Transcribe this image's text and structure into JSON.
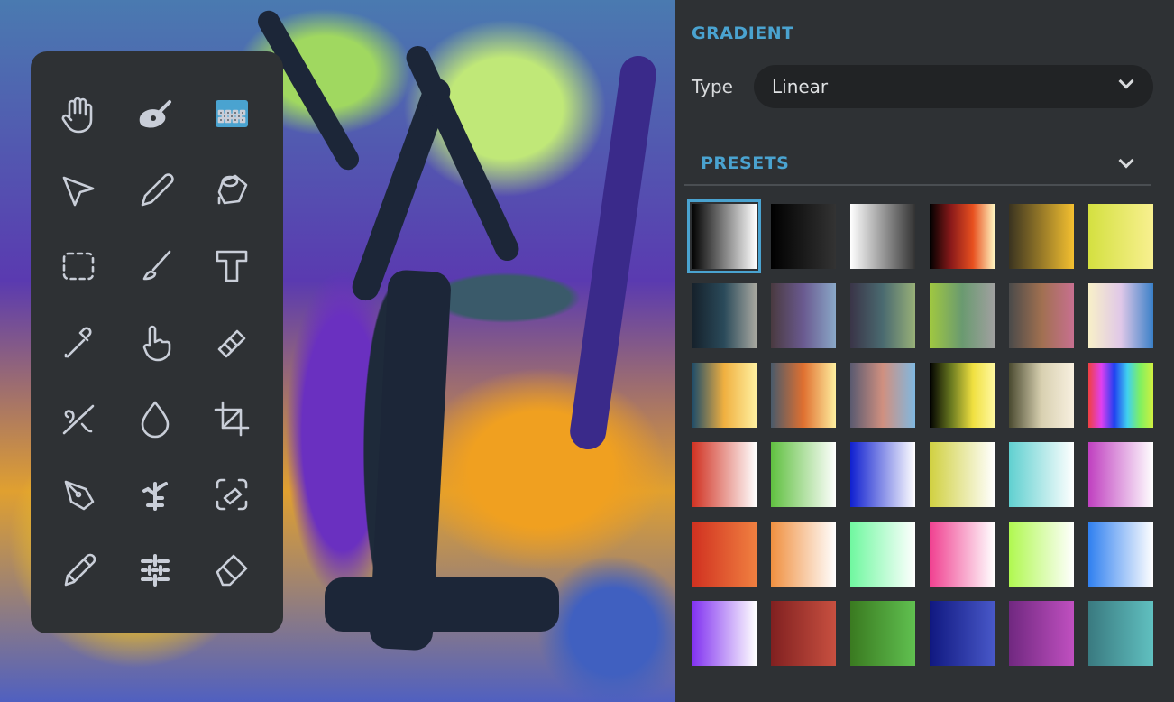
{
  "canvas": {
    "name": "painting-canvas"
  },
  "toolbar": {
    "tools": [
      {
        "id": "hand",
        "active": false
      },
      {
        "id": "palette",
        "active": false
      },
      {
        "id": "gradient",
        "active": true
      },
      {
        "id": "select-arrow",
        "active": false
      },
      {
        "id": "pencil",
        "active": false
      },
      {
        "id": "paint-bucket",
        "active": false
      },
      {
        "id": "marquee",
        "active": false
      },
      {
        "id": "brush",
        "active": false
      },
      {
        "id": "text",
        "active": false
      },
      {
        "id": "eyedropper",
        "active": false
      },
      {
        "id": "finger-smudge",
        "active": false
      },
      {
        "id": "stamp",
        "active": false
      },
      {
        "id": "stroke-pen",
        "active": false
      },
      {
        "id": "blur-drop",
        "active": false
      },
      {
        "id": "crop",
        "active": false
      },
      {
        "id": "pen-nib",
        "active": false
      },
      {
        "id": "tree-pattern",
        "active": false
      },
      {
        "id": "eraser-select",
        "active": false
      },
      {
        "id": "pencil-alt",
        "active": false
      },
      {
        "id": "grid-pattern",
        "active": false
      },
      {
        "id": "eraser",
        "active": false
      }
    ],
    "accent": "#4aa3d0"
  },
  "panel": {
    "gradient_title": "GRADIENT",
    "type_label": "Type",
    "type_value": "Linear",
    "presets_title": "PRESETS",
    "selected_index": 0,
    "presets": [
      [
        "#000000",
        "#ffffff"
      ],
      [
        "#000000",
        "#333333"
      ],
      [
        "#ffffff",
        "#333333"
      ],
      [
        "#000000",
        "#8b1a1a",
        "#e8501f",
        "#fff5c0"
      ],
      [
        "#3a3320",
        "#f4c030"
      ],
      [
        "#d4e040",
        "#f8f090"
      ],
      [
        "#15202a",
        "#2a4a5a",
        "#a8a8a0"
      ],
      [
        "#4a3a40",
        "#6a5a90",
        "#8aa8c8"
      ],
      [
        "#3a3548",
        "#4a6a70",
        "#98b078"
      ],
      [
        "#a0c840",
        "#6a9a70",
        "#a0a0a0"
      ],
      [
        "#4a4a4a",
        "#a07050",
        "#c87090"
      ],
      [
        "#f8f0c8",
        "#e0c8e8",
        "#3a80c8"
      ],
      [
        "#1a4a6a",
        "#f0b040",
        "#fff0a0"
      ],
      [
        "#4a5a6a",
        "#e07030",
        "#fff0a0"
      ],
      [
        "#5a5a70",
        "#d09080",
        "#80b8e0"
      ],
      [
        "#000000",
        "#6a7a20",
        "#f0e040",
        "#fff8a0"
      ],
      [
        "#4a4a30",
        "#d8d0b0",
        "#f8f0e0"
      ],
      [
        "#f04040",
        "#e040f0",
        "#2040f0",
        "#40d0f0",
        "#80f060",
        "#d0f040"
      ],
      [
        "#d03020",
        "#ffffff"
      ],
      [
        "#60c040",
        "#ffffff"
      ],
      [
        "#1020d0",
        "#ffffff"
      ],
      [
        "#d0d040",
        "#ffffff"
      ],
      [
        "#60d0d0",
        "#ffffff"
      ],
      [
        "#c040c0",
        "#ffffff"
      ],
      [
        "#d03020",
        "#f08040"
      ],
      [
        "#f09040",
        "#ffffff"
      ],
      [
        "#70f8a0",
        "#ffffff"
      ],
      [
        "#f04090",
        "#ffffff"
      ],
      [
        "#b0f850",
        "#ffffff"
      ],
      [
        "#3080f0",
        "#ffffff"
      ],
      [
        "#8030f0",
        "#ffffff"
      ],
      [
        "#802020",
        "#c85040"
      ],
      [
        "#3a7a20",
        "#60c050"
      ],
      [
        "#101880",
        "#4858c8"
      ],
      [
        "#702880",
        "#c050c0"
      ],
      [
        "#3a7a80",
        "#60c0c0"
      ]
    ]
  }
}
